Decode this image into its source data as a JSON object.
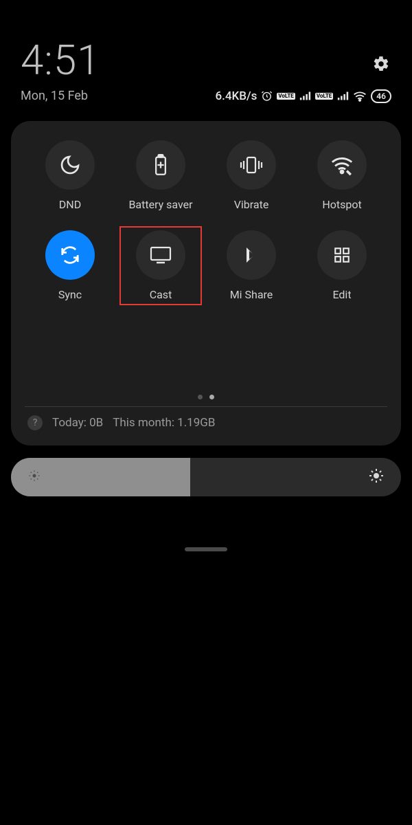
{
  "header": {
    "time": "4:51",
    "date": "Mon, 15 Feb",
    "network_speed": "6.4KB/s",
    "battery_percent": "46",
    "lte_badge": "VoLTE"
  },
  "tiles": [
    {
      "id": "dnd",
      "label": "DND",
      "icon": "moon",
      "active": false,
      "highlighted": false
    },
    {
      "id": "battery",
      "label": "Battery saver",
      "icon": "battery+",
      "active": false,
      "highlighted": false
    },
    {
      "id": "vibrate",
      "label": "Vibrate",
      "icon": "vibrate",
      "active": false,
      "highlighted": false
    },
    {
      "id": "hotspot",
      "label": "Hotspot",
      "icon": "hotspot",
      "active": false,
      "highlighted": false
    },
    {
      "id": "sync",
      "label": "Sync",
      "icon": "sync",
      "active": true,
      "highlighted": false
    },
    {
      "id": "cast",
      "label": "Cast",
      "icon": "cast",
      "active": false,
      "highlighted": true
    },
    {
      "id": "mishare",
      "label": "Mi Share",
      "icon": "mishare",
      "active": false,
      "highlighted": false
    },
    {
      "id": "edit",
      "label": "Edit",
      "icon": "grid",
      "active": false,
      "highlighted": false
    }
  ],
  "pager": {
    "count": 2,
    "active_index": 1
  },
  "data_usage": {
    "today_label": "Today: 0B",
    "month_label": "This month: 1.19GB"
  },
  "brightness": {
    "percent": 46
  },
  "colors": {
    "accent": "#0a84ff",
    "panel": "#1e1e1e",
    "tile": "#2b2b2b",
    "highlight": "#e53935"
  }
}
